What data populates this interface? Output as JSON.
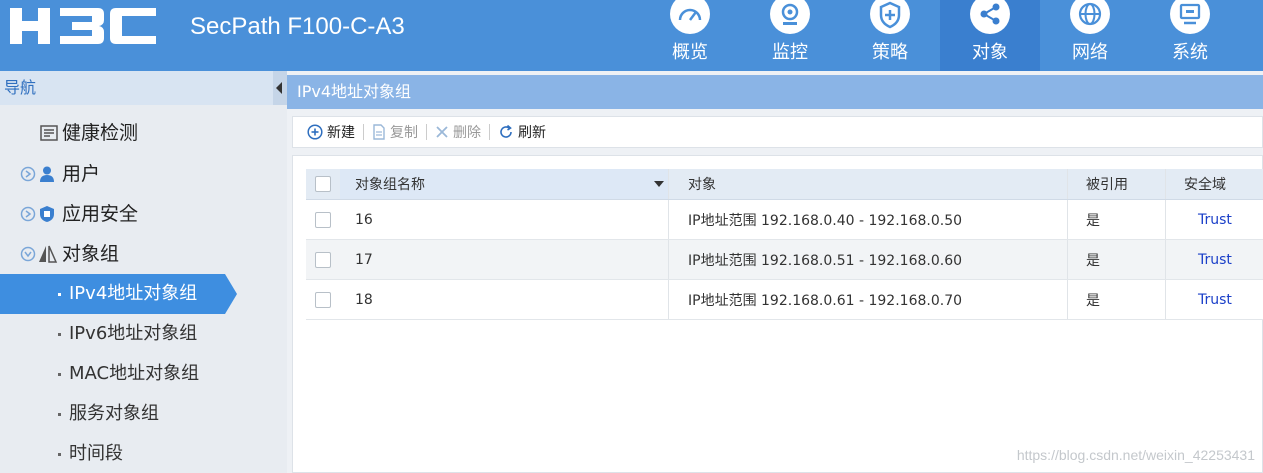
{
  "header": {
    "product_name": "SecPath F100-C-A3",
    "nav": [
      {
        "label": "概览",
        "icon": "dashboard-icon"
      },
      {
        "label": "监控",
        "icon": "camera-icon"
      },
      {
        "label": "策略",
        "icon": "shield-plus-icon"
      },
      {
        "label": "对象",
        "icon": "share-icon",
        "active": true
      },
      {
        "label": "网络",
        "icon": "globe-icon"
      },
      {
        "label": "系统",
        "icon": "monitor-icon"
      }
    ]
  },
  "sidebar": {
    "title": "导航",
    "menu": [
      {
        "label": "健康检测",
        "icon": "list-icon"
      },
      {
        "label": "用户",
        "icon": "user-icon"
      },
      {
        "label": "应用安全",
        "icon": "shield-icon"
      },
      {
        "label": "对象组",
        "icon": "triangle-icon"
      }
    ],
    "submenu": [
      {
        "label": "IPv4地址对象组",
        "active": true
      },
      {
        "label": "IPv6地址对象组"
      },
      {
        "label": "MAC地址对象组"
      },
      {
        "label": "服务对象组"
      },
      {
        "label": "时间段"
      }
    ]
  },
  "main": {
    "title": "IPv4地址对象组",
    "toolbar": {
      "new": "新建",
      "copy": "复制",
      "delete": "删除",
      "refresh": "刷新"
    },
    "table": {
      "columns": [
        "对象组名称",
        "对象",
        "被引用",
        "安全域"
      ],
      "rows": [
        {
          "name": "16",
          "object": "IP地址范围 192.168.0.40 - 192.168.0.50",
          "referenced": "是",
          "zone": "Trust"
        },
        {
          "name": "17",
          "object": "IP地址范围 192.168.0.51 - 192.168.0.60",
          "referenced": "是",
          "zone": "Trust"
        },
        {
          "name": "18",
          "object": "IP地址范围 192.168.0.61 - 192.168.0.70",
          "referenced": "是",
          "zone": "Trust"
        }
      ]
    }
  },
  "watermark": "https://blog.csdn.net/weixin_42253431",
  "colors": {
    "header_bg": "#4a90d9",
    "active_nav": "#3a7fcf",
    "active_menu": "#3e8ee0",
    "zone_text": "#1a3fc8"
  }
}
